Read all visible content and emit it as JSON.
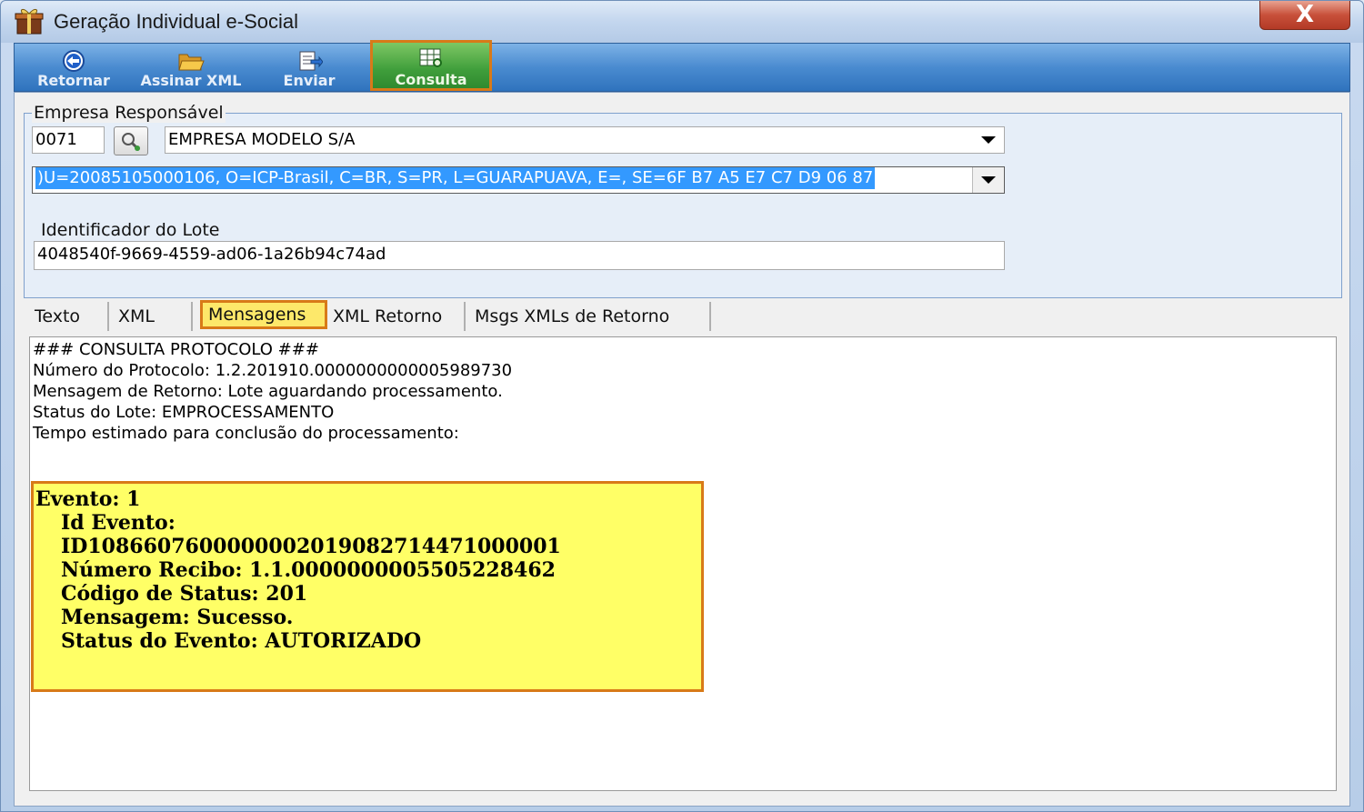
{
  "window": {
    "title": "Geração Individual e-Social",
    "close_label": "X"
  },
  "toolbar": {
    "buttons": [
      {
        "label": "Retornar",
        "icon": "back-arrow-icon"
      },
      {
        "label": "Assinar XML",
        "icon": "folder-open-icon"
      },
      {
        "label": "Enviar",
        "icon": "send-document-icon"
      },
      {
        "label": "Consulta",
        "icon": "table-search-icon"
      }
    ],
    "active": "Consulta"
  },
  "empresa": {
    "group_label": "Empresa Responsável",
    "code": "0071",
    "name": "EMPRESA MODELO S/A",
    "certificate": ")U=20085105000106, O=ICP-Brasil, C=BR, S=PR, L=GUARAPUAVA, E=, SE=6F B7 A5 E7 C7 D9 06 87"
  },
  "lote": {
    "label": "Identificador do Lote",
    "value": "4048540f-9669-4559-ad06-1a26b94c74ad"
  },
  "tabs": [
    {
      "label": "Texto"
    },
    {
      "label": "XML"
    },
    {
      "label": "Mensagens"
    },
    {
      "label": "XML Retorno"
    },
    {
      "label": "Msgs XMLs de Retorno"
    }
  ],
  "active_tab": "Mensagens",
  "messages": {
    "lines": [
      "### CONSULTA PROTOCOLO ###",
      "Número do Protocolo: 1.2.201910.0000000000005989730",
      "Mensagem de Retorno: Lote aguardando processamento.",
      "Status do Lote: EMPROCESSAMENTO",
      "Tempo estimado para conclusão do processamento:"
    ],
    "evento": [
      "Evento: 1",
      "Id Evento:",
      "ID1086607600000002019082714471000001",
      "Número Recibo: 1.1.0000000005505228462",
      "Código de Status: 201",
      "Mensagem: Sucesso.",
      "Status do Evento: AUTORIZADO"
    ]
  },
  "colors": {
    "highlight_border": "#d87a18",
    "highlight_fill": "#ffff66",
    "toolbar_blue": "#4a8bd0",
    "active_green": "#3f9e3b"
  }
}
